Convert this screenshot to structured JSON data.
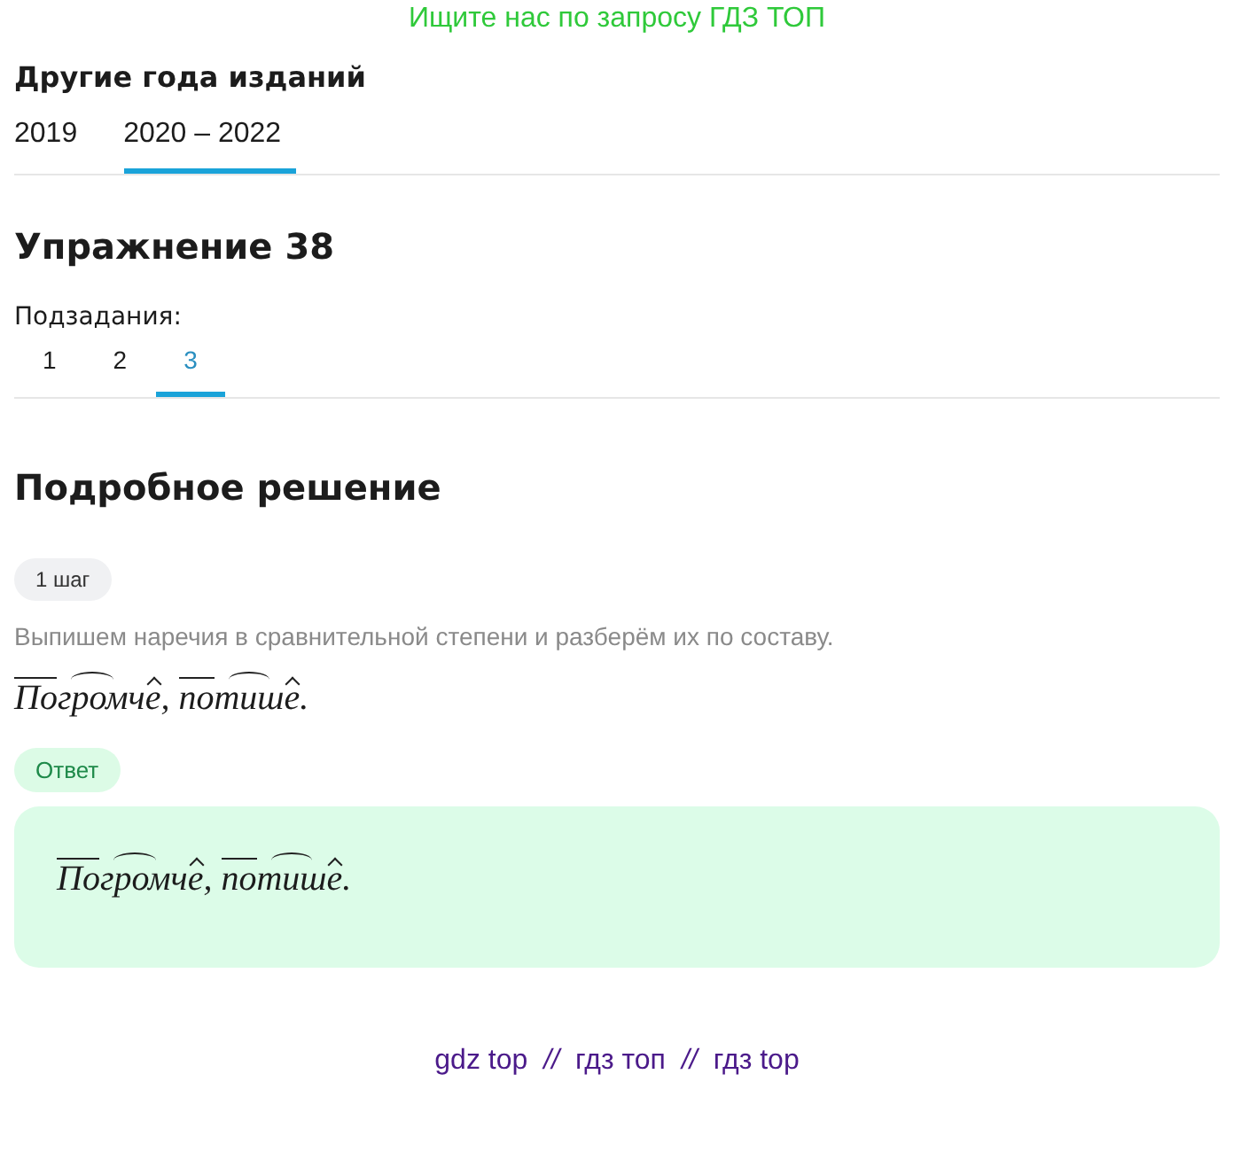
{
  "banner": "Ищите нас по запросу ГДЗ ТОП",
  "editions": {
    "title": "Другие года изданий",
    "tabs": [
      {
        "label": "2019",
        "selected": false
      },
      {
        "label": "2020 – 2022",
        "selected": true
      }
    ]
  },
  "exercise": {
    "title": "Упражнение 38",
    "subtasks_label": "Подзадания:",
    "subtasks": [
      {
        "label": "1",
        "selected": false
      },
      {
        "label": "2",
        "selected": false
      },
      {
        "label": "3",
        "selected": true
      }
    ]
  },
  "solution": {
    "title": "Подробное решение",
    "step_badge": "1 шаг",
    "step_text": "Выпишем наречия в сравнительной степени и разберём их по составу.",
    "analysis": [
      {
        "text": "По",
        "kind": "prefix"
      },
      {
        "text": "гром",
        "kind": "root"
      },
      {
        "text": "ч",
        "kind": "plain"
      },
      {
        "text": "е",
        "kind": "suffix"
      },
      {
        "text": ", ",
        "kind": "plain"
      },
      {
        "text": "по",
        "kind": "prefix"
      },
      {
        "text": "тиш",
        "kind": "root"
      },
      {
        "text": "е",
        "kind": "suffix"
      },
      {
        "text": ".",
        "kind": "plain"
      }
    ],
    "answer_badge": "Ответ",
    "answer": [
      {
        "text": "По",
        "kind": "prefix"
      },
      {
        "text": "гром",
        "kind": "root"
      },
      {
        "text": "ч",
        "kind": "plain"
      },
      {
        "text": "е",
        "kind": "suffix"
      },
      {
        "text": ", ",
        "kind": "plain"
      },
      {
        "text": "по",
        "kind": "prefix"
      },
      {
        "text": "тиш",
        "kind": "root"
      },
      {
        "text": "е",
        "kind": "suffix"
      },
      {
        "text": ".",
        "kind": "plain"
      }
    ]
  },
  "footer_links": [
    {
      "kind": "link",
      "text": "gdz top"
    },
    {
      "kind": "sep",
      "text": "//"
    },
    {
      "kind": "link",
      "text": "гдз топ"
    },
    {
      "kind": "sep",
      "text": "//"
    },
    {
      "kind": "link",
      "text": "гдз top"
    }
  ]
}
